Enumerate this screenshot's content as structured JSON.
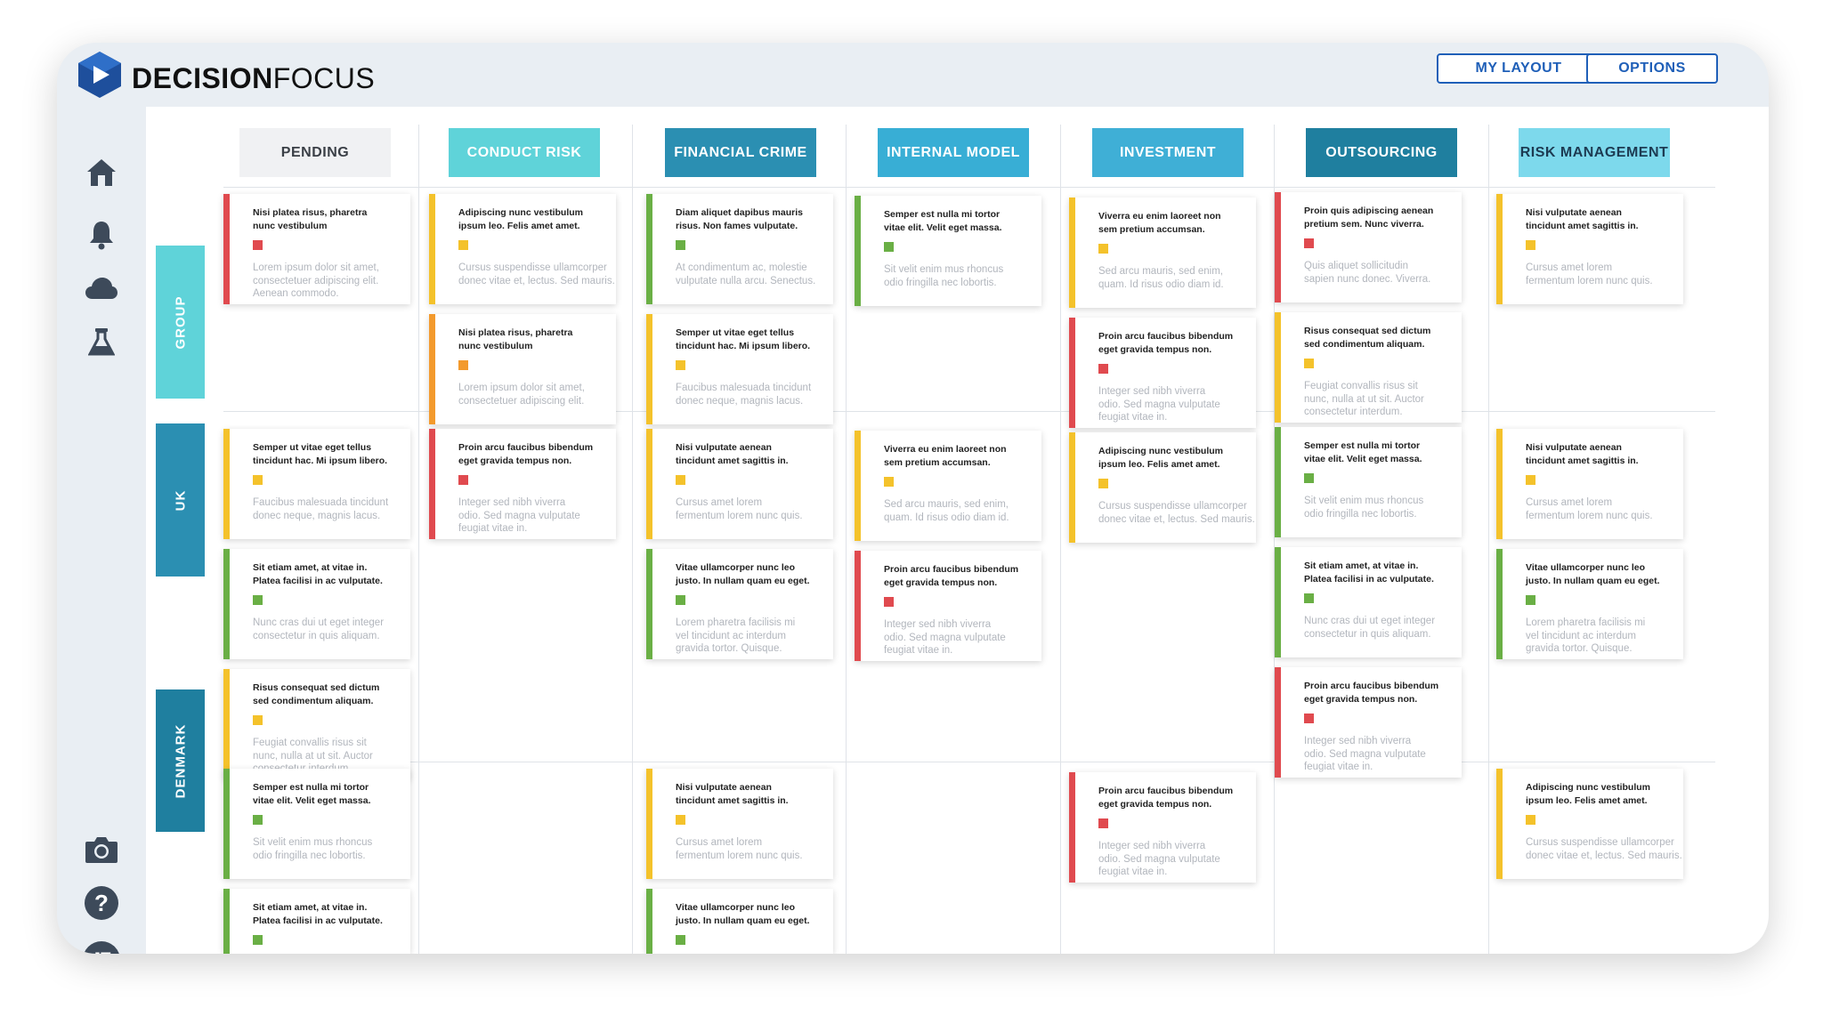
{
  "app": {
    "brand_bold": "DECISION",
    "brand_light": "FOCUS",
    "layout_button": "MY LAYOUT",
    "options_button": "OPTIONS",
    "avatar_initials": "JT"
  },
  "colors": {
    "red": "#e04a4f",
    "yellow": "#f4c22b",
    "green": "#6aaf45",
    "orange": "#f39a2d"
  },
  "sidebar": {
    "top_icons": [
      "home-icon",
      "bell-icon",
      "cloud-icon",
      "flask-icon"
    ],
    "bottom_icons": [
      "camera-icon",
      "help-icon"
    ]
  },
  "columns": [
    {
      "label": "PENDING",
      "bg": "#f0f1f3",
      "fg": "#3a3f46"
    },
    {
      "label": "CONDUCT RISK",
      "bg": "#5fd3d9",
      "fg": "#ffffff"
    },
    {
      "label": "FINANCIAL CRIME",
      "bg": "#2b8fb2",
      "fg": "#ffffff"
    },
    {
      "label": "INTERNAL MODEL",
      "bg": "#38aed5",
      "fg": "#ffffff"
    },
    {
      "label": "INVESTMENT",
      "bg": "#3fafd6",
      "fg": "#ffffff"
    },
    {
      "label": "OUTSOURCING",
      "bg": "#1f7f9f",
      "fg": "#ffffff"
    },
    {
      "label": "RISK MANAGEMENT",
      "bg": "#7dd9ec",
      "fg": "#1d3b52"
    }
  ],
  "rows": [
    {
      "label": "GROUP",
      "bg": "#5fd3d9"
    },
    {
      "label": "UK",
      "bg": "#2b8fb2"
    },
    {
      "label": "DENMARK",
      "bg": "#1f7f9f"
    }
  ],
  "cards": [
    {
      "col": 0,
      "row": 0,
      "color": "red",
      "title": [
        "Nisi platea risus, pharetra",
        "nunc vestibulum"
      ],
      "body": [
        "Lorem ipsum dolor sit amet,",
        "consectetuer adipiscing elit.",
        "Aenean commodo."
      ]
    },
    {
      "col": 0,
      "row": 1,
      "color": "yellow",
      "title": [
        "Semper ut vitae eget tellus",
        "tincidunt hac. Mi ipsum libero."
      ],
      "body": [
        "Faucibus malesuada tincidunt",
        "donec neque, magnis lacus."
      ]
    },
    {
      "col": 0,
      "row": 1,
      "color": "green",
      "title": [
        "Sit etiam amet, at vitae in.",
        "Platea facilisi in ac vulputate."
      ],
      "body": [
        "Nunc cras dui ut eget integer",
        "consectetur in quis aliquam."
      ]
    },
    {
      "col": 0,
      "row": 1,
      "color": "yellow",
      "title": [
        "Risus consequat sed dictum",
        "sed condimentum aliquam."
      ],
      "body": [
        "Feugiat convallis risus sit",
        "nunc, nulla at ut sit. Auctor",
        "consectetur interdum."
      ]
    },
    {
      "col": 0,
      "row": 2,
      "color": "green",
      "title": [
        "Semper est nulla mi tortor",
        "vitae elit. Velit eget massa."
      ],
      "body": [
        "Sit velit enim mus rhoncus",
        "odio fringilla nec lobortis."
      ]
    },
    {
      "col": 0,
      "row": 2,
      "color": "green",
      "title": [
        "Sit etiam amet, at vitae in.",
        "Platea facilisi in ac vulputate."
      ],
      "body": []
    },
    {
      "col": 1,
      "row": 0,
      "color": "yellow",
      "title": [
        "Adipiscing nunc vestibulum",
        "ipsum leo. Felis amet amet."
      ],
      "body": [
        "Cursus suspendisse ullamcorper",
        "donec vitae et, lectus. Sed mauris."
      ]
    },
    {
      "col": 1,
      "row": 0,
      "color": "orange",
      "title": [
        "Nisi platea risus, pharetra",
        "nunc vestibulum"
      ],
      "body": [
        "Lorem ipsum dolor sit amet,",
        "consectetuer adipiscing elit."
      ]
    },
    {
      "col": 1,
      "row": 1,
      "color": "red",
      "title": [
        "Proin arcu faucibus bibendum",
        "eget gravida tempus non."
      ],
      "body": [
        "Integer sed nibh viverra",
        "odio. Sed magna vulputate",
        "feugiat vitae in."
      ]
    },
    {
      "col": 2,
      "row": 0,
      "color": "green",
      "title": [
        "Diam aliquet dapibus mauris",
        "risus. Non fames vulputate."
      ],
      "body": [
        "At condimentum ac, molestie",
        "vulputate nulla arcu. Senectus."
      ]
    },
    {
      "col": 2,
      "row": 0,
      "color": "yellow",
      "title": [
        "Semper ut vitae eget tellus",
        "tincidunt hac. Mi ipsum libero."
      ],
      "body": [
        "Faucibus malesuada tincidunt",
        "donec neque, magnis lacus."
      ]
    },
    {
      "col": 2,
      "row": 1,
      "color": "yellow",
      "title": [
        "Nisi vulputate aenean",
        "tincidunt amet sagittis in."
      ],
      "body": [
        "Cursus amet lorem",
        "fermentum lorem nunc quis."
      ]
    },
    {
      "col": 2,
      "row": 1,
      "color": "green",
      "title": [
        "Vitae ullamcorper nunc leo",
        "justo. In nullam quam eu eget."
      ],
      "body": [
        "Lorem pharetra facilisis mi",
        "vel tincidunt ac interdum",
        "gravida tortor. Quisque."
      ]
    },
    {
      "col": 2,
      "row": 2,
      "color": "yellow",
      "title": [
        "Nisi vulputate aenean",
        "tincidunt amet sagittis in."
      ],
      "body": [
        "Cursus amet lorem",
        "fermentum lorem nunc quis."
      ]
    },
    {
      "col": 2,
      "row": 2,
      "color": "green",
      "title": [
        "Vitae ullamcorper nunc leo",
        "justo. In nullam quam eu eget."
      ],
      "body": []
    },
    {
      "col": 3,
      "row": 0,
      "color": "green",
      "title": [
        "Semper est nulla mi tortor",
        "vitae elit. Velit eget massa."
      ],
      "body": [
        "Sit velit enim mus rhoncus",
        "odio fringilla nec lobortis."
      ]
    },
    {
      "col": 3,
      "row": 1,
      "color": "yellow",
      "title": [
        "Viverra eu enim laoreet non",
        "sem pretium accumsan."
      ],
      "body": [
        "Sed arcu mauris, sed enim,",
        "quam. Id risus odio diam id."
      ]
    },
    {
      "col": 3,
      "row": 1,
      "color": "red",
      "title": [
        "Proin arcu faucibus bibendum",
        "eget gravida tempus non."
      ],
      "body": [
        "Integer sed nibh viverra",
        "odio. Sed magna vulputate",
        "feugiat vitae in."
      ]
    },
    {
      "col": 4,
      "row": 0,
      "color": "yellow",
      "title": [
        "Viverra eu enim laoreet non",
        "sem pretium accumsan."
      ],
      "body": [
        "Sed arcu mauris, sed enim,",
        "quam. Id risus odio diam id."
      ]
    },
    {
      "col": 4,
      "row": 0,
      "color": "red",
      "title": [
        "Proin arcu faucibus bibendum",
        "eget gravida tempus non."
      ],
      "body": [
        "Integer sed nibh viverra",
        "odio. Sed magna vulputate",
        "feugiat vitae in."
      ]
    },
    {
      "col": 4,
      "row": 1,
      "color": "yellow",
      "title": [
        "Adipiscing nunc vestibulum",
        "ipsum leo. Felis amet amet."
      ],
      "body": [
        "Cursus suspendisse ullamcorper",
        "donec vitae et, lectus. Sed mauris."
      ]
    },
    {
      "col": 4,
      "row": 2,
      "color": "red",
      "title": [
        "Proin arcu faucibus bibendum",
        "eget gravida tempus non."
      ],
      "body": [
        "Integer sed nibh viverra",
        "odio. Sed magna vulputate",
        "feugiat vitae in."
      ]
    },
    {
      "col": 5,
      "row": 0,
      "color": "red",
      "title": [
        "Proin quis adipiscing aenean",
        "pretium sem. Nunc viverra."
      ],
      "body": [
        "Quis aliquet sollicitudin",
        "sapien nunc donec. Viverra."
      ]
    },
    {
      "col": 5,
      "row": 0,
      "color": "yellow",
      "title": [
        "Risus consequat sed dictum",
        "sed condimentum aliquam."
      ],
      "body": [
        "Feugiat convallis risus sit",
        "nunc, nulla at ut sit. Auctor",
        "consectetur interdum."
      ]
    },
    {
      "col": 5,
      "row": 1,
      "color": "green",
      "title": [
        "Semper est nulla mi tortor",
        "vitae elit. Velit eget massa."
      ],
      "body": [
        "Sit velit enim mus rhoncus",
        "odio fringilla nec lobortis."
      ]
    },
    {
      "col": 5,
      "row": 1,
      "color": "green",
      "title": [
        "Sit etiam amet, at vitae in.",
        "Platea facilisi in ac vulputate."
      ],
      "body": [
        "Nunc cras dui ut eget integer",
        "consectetur in quis aliquam."
      ]
    },
    {
      "col": 5,
      "row": 1,
      "color": "red",
      "title": [
        "Proin arcu faucibus bibendum",
        "eget gravida tempus non."
      ],
      "body": [
        "Integer sed nibh viverra",
        "odio. Sed magna vulputate",
        "feugiat vitae in."
      ]
    },
    {
      "col": 6,
      "row": 0,
      "color": "yellow",
      "title": [
        "Nisi vulputate aenean",
        "tincidunt amet sagittis in."
      ],
      "body": [
        "Cursus amet lorem",
        "fermentum lorem nunc quis."
      ]
    },
    {
      "col": 6,
      "row": 1,
      "color": "yellow",
      "title": [
        "Nisi vulputate aenean",
        "tincidunt amet sagittis in."
      ],
      "body": [
        "Cursus amet lorem",
        "fermentum lorem nunc quis."
      ]
    },
    {
      "col": 6,
      "row": 1,
      "color": "green",
      "title": [
        "Vitae ullamcorper nunc leo",
        "justo. In nullam quam eu eget."
      ],
      "body": [
        "Lorem pharetra facilisis mi",
        "vel tincidunt ac interdum",
        "gravida tortor. Quisque."
      ]
    },
    {
      "col": 6,
      "row": 2,
      "color": "yellow",
      "title": [
        "Adipiscing nunc vestibulum",
        "ipsum leo. Felis amet amet."
      ],
      "body": [
        "Cursus suspendisse ullamcorper",
        "donec vitae et, lectus. Sed mauris."
      ]
    }
  ]
}
